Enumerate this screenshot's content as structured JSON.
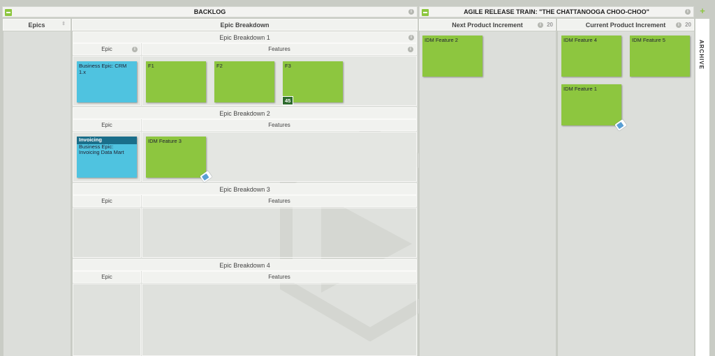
{
  "backlog": {
    "title": "BACKLOG",
    "epics_label": "Epics",
    "breakdown_label": "Epic Breakdown",
    "breakdowns": [
      {
        "title": "Epic Breakdown 1",
        "epic_col": "Epic",
        "features_col": "Features"
      },
      {
        "title": "Epic Breakdown 2",
        "epic_col": "Epic",
        "features_col": "Features"
      },
      {
        "title": "Epic Breakdown 3",
        "epic_col": "Epic",
        "features_col": "Features"
      },
      {
        "title": "Epic Breakdown 4",
        "epic_col": "Epic",
        "features_col": "Features"
      }
    ],
    "cards": {
      "epic1": "Business Epic: CRM 1.x",
      "f1": "F1",
      "f2": "F2",
      "f3": "F3",
      "f3_badge": "45",
      "epic2_tag": "Invoicing",
      "epic2": "Business Epic: Invoicing Data Mart",
      "idm3": "IDM Feature 3"
    }
  },
  "art": {
    "title": "AGILE RELEASE TRAIN: \"THE CHATTANOOGA CHOO-CHOO\"",
    "next": {
      "title": "Next Product Increment",
      "count": "20",
      "cards": [
        "IDM Feature 2"
      ]
    },
    "current": {
      "title": "Current Product Increment",
      "count": "20",
      "cards": [
        "IDM Feature 4",
        "IDM Feature 5",
        "IDM Feature 1"
      ]
    }
  },
  "archive_label": "ARCHIVE",
  "colors": {
    "feature": "#8dc63f",
    "epic": "#4fc3e0",
    "accent": "#8dc63f"
  }
}
